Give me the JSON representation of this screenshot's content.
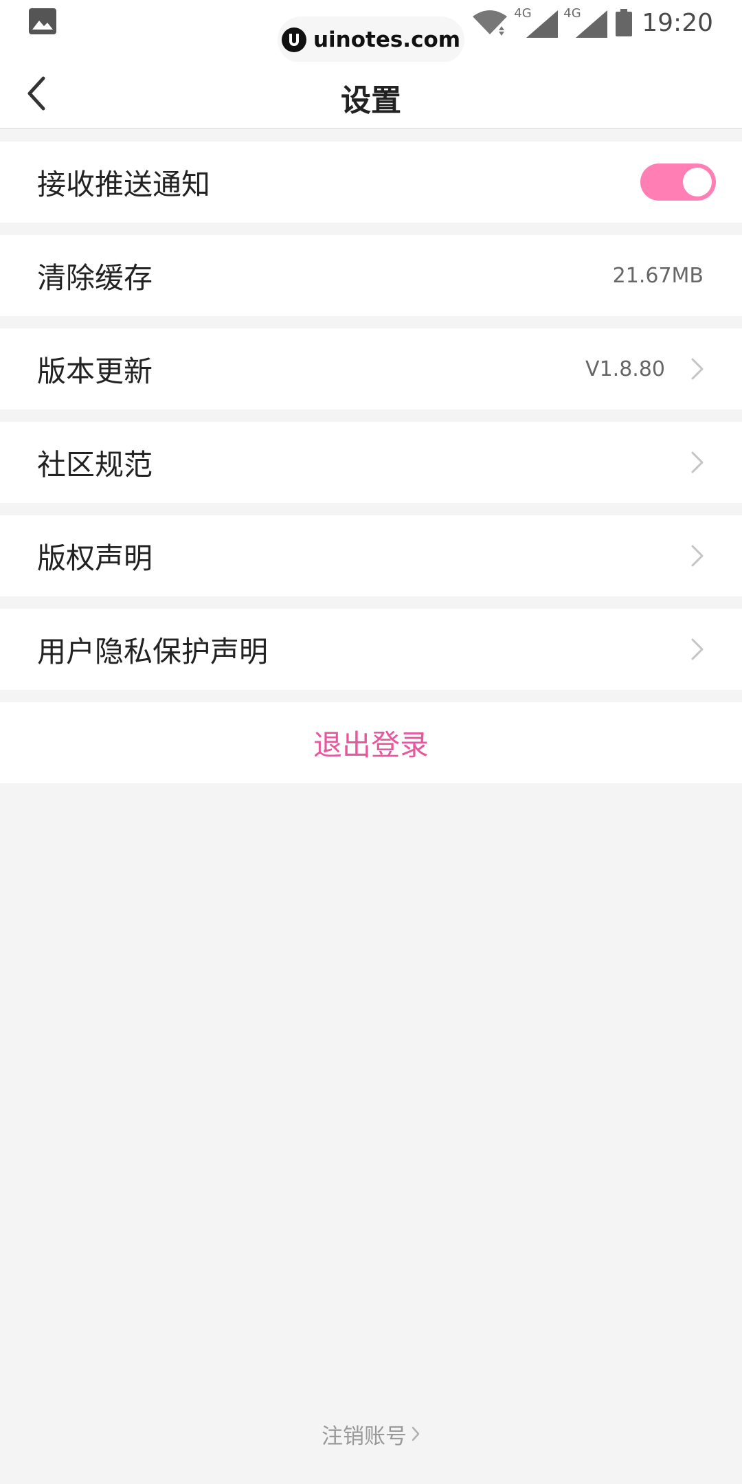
{
  "status_bar": {
    "watermark_text": "uinotes.com",
    "network_1": "4G",
    "network_2": "4G",
    "time": "19:20",
    "icons": [
      "photo-icon",
      "wifi-icon",
      "cell-signal-icon",
      "cell-signal-icon",
      "battery-icon"
    ]
  },
  "header": {
    "title": "设置",
    "back_icon": "chevron-left-icon"
  },
  "settings": {
    "push": {
      "label": "接收推送通知",
      "enabled": true
    },
    "cache": {
      "label": "清除缓存",
      "value": "21.67MB"
    },
    "version": {
      "label": "版本更新",
      "value": "V1.8.80"
    },
    "community": {
      "label": "社区规范"
    },
    "copyright": {
      "label": "版权声明"
    },
    "privacy": {
      "label": "用户隐私保护声明"
    }
  },
  "logout": {
    "label": "退出登录"
  },
  "cancel_account": {
    "label": "注销账号"
  },
  "colors": {
    "accent": "#ff7eb3",
    "logout_text": "#e8569e",
    "background": "#f4f4f4",
    "row_background": "#ffffff",
    "chevron": "#c4c4c4"
  }
}
